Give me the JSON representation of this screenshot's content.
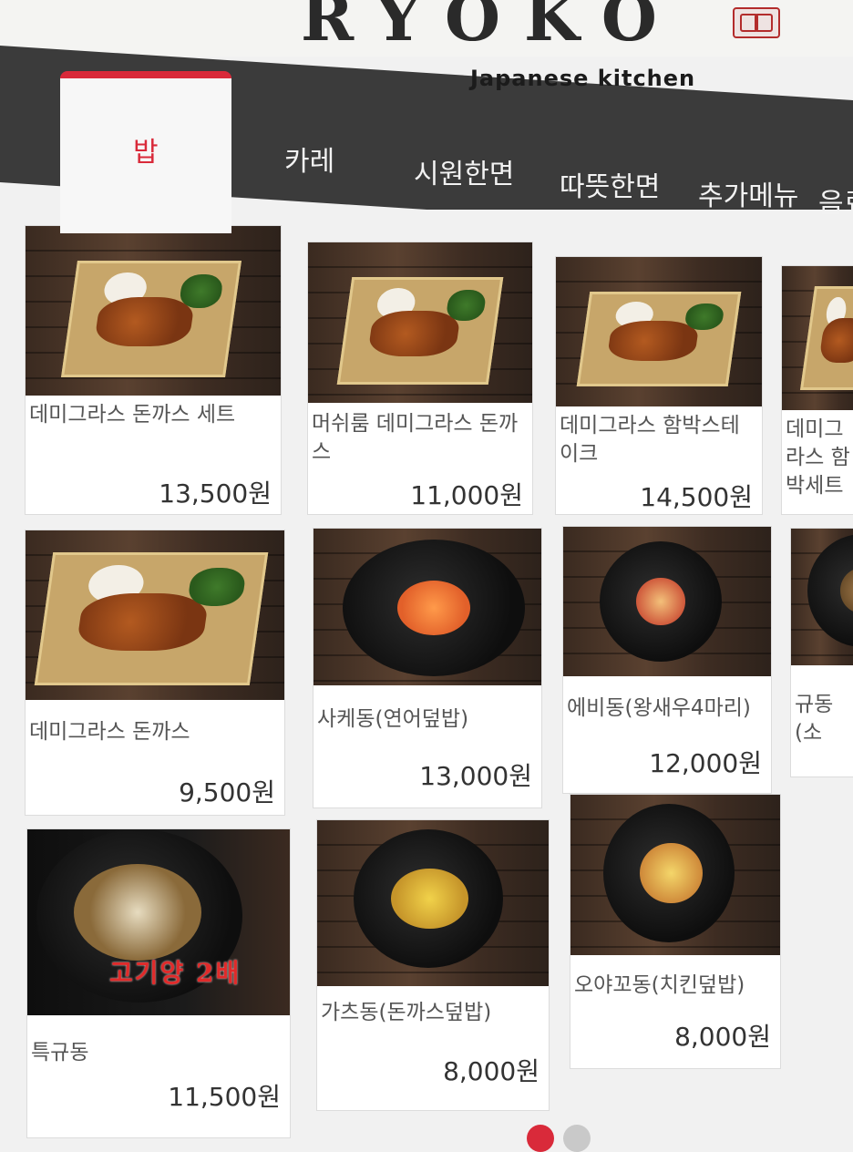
{
  "header": {
    "brand": "RYOKO",
    "subtitle": "Japanese kitchen"
  },
  "tabs": [
    {
      "label": "밥",
      "active": true
    },
    {
      "label": "카레",
      "active": false
    },
    {
      "label": "시원한면",
      "active": false
    },
    {
      "label": "따뜻한면",
      "active": false
    },
    {
      "label": "추가메뉴",
      "active": false
    },
    {
      "label": "음료",
      "active": false
    }
  ],
  "menu": [
    {
      "name": "데미그라스 돈까스 세트",
      "price": "13,500원",
      "image": "plate-image"
    },
    {
      "name": "머쉬룸 데미그라스 돈까스",
      "price": "11,000원",
      "image": "plate-image"
    },
    {
      "name": "데미그라스 함박스테이크",
      "price": "14,500원",
      "image": "plate-image"
    },
    {
      "name": "데미그라스 함박세트",
      "price": "",
      "image": "plate-image"
    },
    {
      "name": "데미그라스 돈까스",
      "price": "9,500원",
      "image": "plate-image"
    },
    {
      "name": "사케동(연어덮밥)",
      "price": "13,000원",
      "image": "bowl-image"
    },
    {
      "name": "에비동(왕새우4마리)",
      "price": "12,000원",
      "image": "bowl-image"
    },
    {
      "name": "규동(소",
      "price": "",
      "image": "bowl-image"
    },
    {
      "name": "특규동",
      "price": "11,500원",
      "image": "bowl-image",
      "badge": "고기양 2배"
    },
    {
      "name": "가츠동(돈까스덮밥)",
      "price": "8,000원",
      "image": "bowl-image"
    },
    {
      "name": "오야꼬동(치킨덮밥)",
      "price": "8,000원",
      "image": "bowl-image"
    }
  ],
  "pagination": {
    "current": 1,
    "total": 2
  },
  "colors": {
    "accent": "#d92a3a",
    "nav": "#3b3b3b"
  }
}
